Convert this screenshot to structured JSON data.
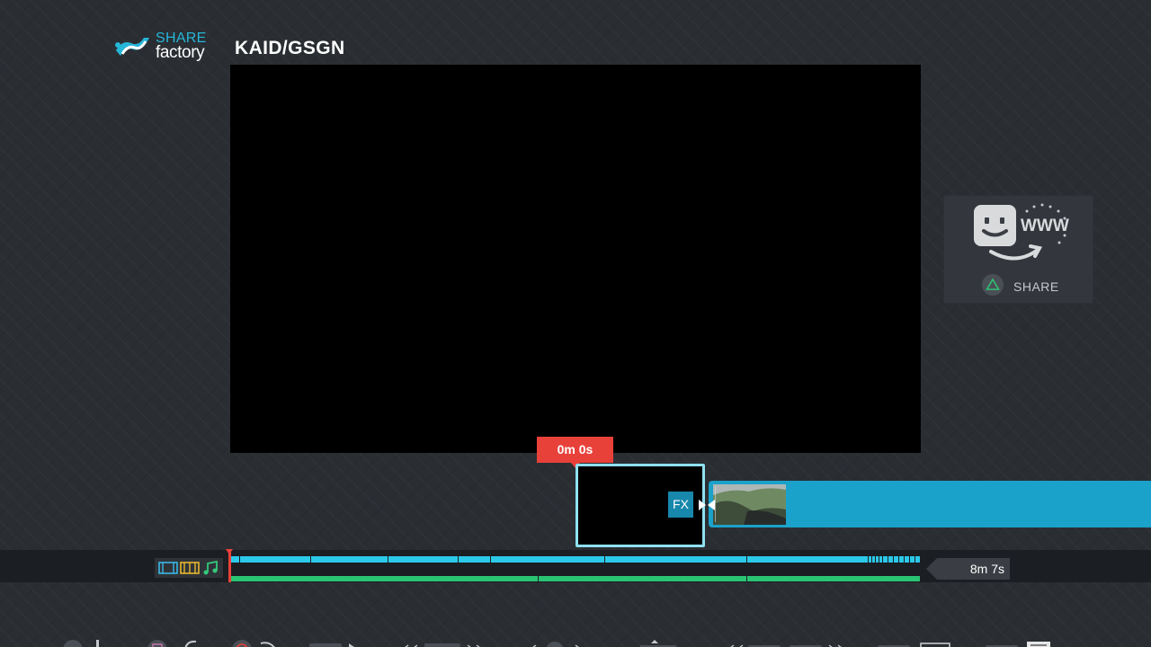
{
  "app": {
    "logo_line1": "SHARE",
    "logo_line2": "factory",
    "project_title": "KAID/GSGN"
  },
  "share_panel": {
    "www_text": "WWW",
    "button_label": "SHARE",
    "button_icon": "triangle-icon"
  },
  "timeline": {
    "current_time": "0m 0s",
    "total_duration": "8m 7s",
    "fx_label": "FX",
    "playhead_position": 0,
    "track_icons": [
      "video-track-icon",
      "film-track-icon",
      "music-track-icon"
    ]
  },
  "colors": {
    "accent_cyan": "#2cc9ea",
    "clip_blue": "#1aa2ca",
    "audio_green": "#29c474",
    "playhead_red": "#e8413a"
  }
}
